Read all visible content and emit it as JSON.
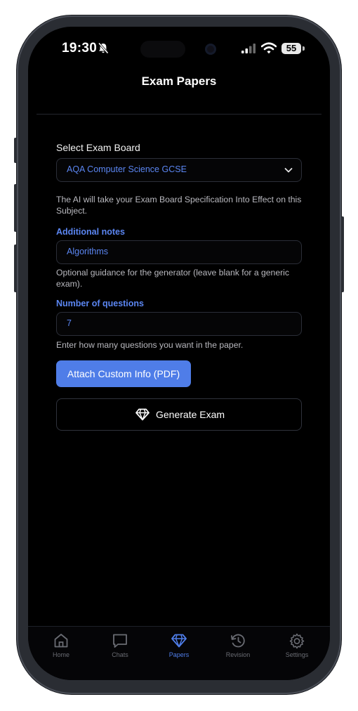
{
  "status_bar": {
    "time": "19:30",
    "battery": "55"
  },
  "header": {
    "title": "Exam Papers"
  },
  "form": {
    "exam_board_label": "Select Exam Board",
    "exam_board_value": "AQA Computer Science GCSE",
    "exam_board_help": "The AI will take your Exam Board Specification Into Effect on this Subject.",
    "notes_label": "Additional notes",
    "notes_value": "Algorithms",
    "notes_help": "Optional guidance for the generator (leave blank for a generic exam).",
    "questions_label": "Number of questions",
    "questions_value": "7",
    "questions_help": "Enter how many questions you want in the paper.",
    "attach_label": "Attach Custom Info (PDF)",
    "generate_label": "Generate Exam"
  },
  "tabs": [
    {
      "label": "Home",
      "icon": "home-icon"
    },
    {
      "label": "Chats",
      "icon": "chat-bubble-icon"
    },
    {
      "label": "Papers",
      "icon": "diamond-icon",
      "active": true
    },
    {
      "label": "Revision",
      "icon": "history-icon"
    },
    {
      "label": "Settings",
      "icon": "gear-icon"
    }
  ],
  "colors": {
    "accent": "#4f7de8",
    "background": "#000000",
    "link_text": "#5b86f2"
  }
}
